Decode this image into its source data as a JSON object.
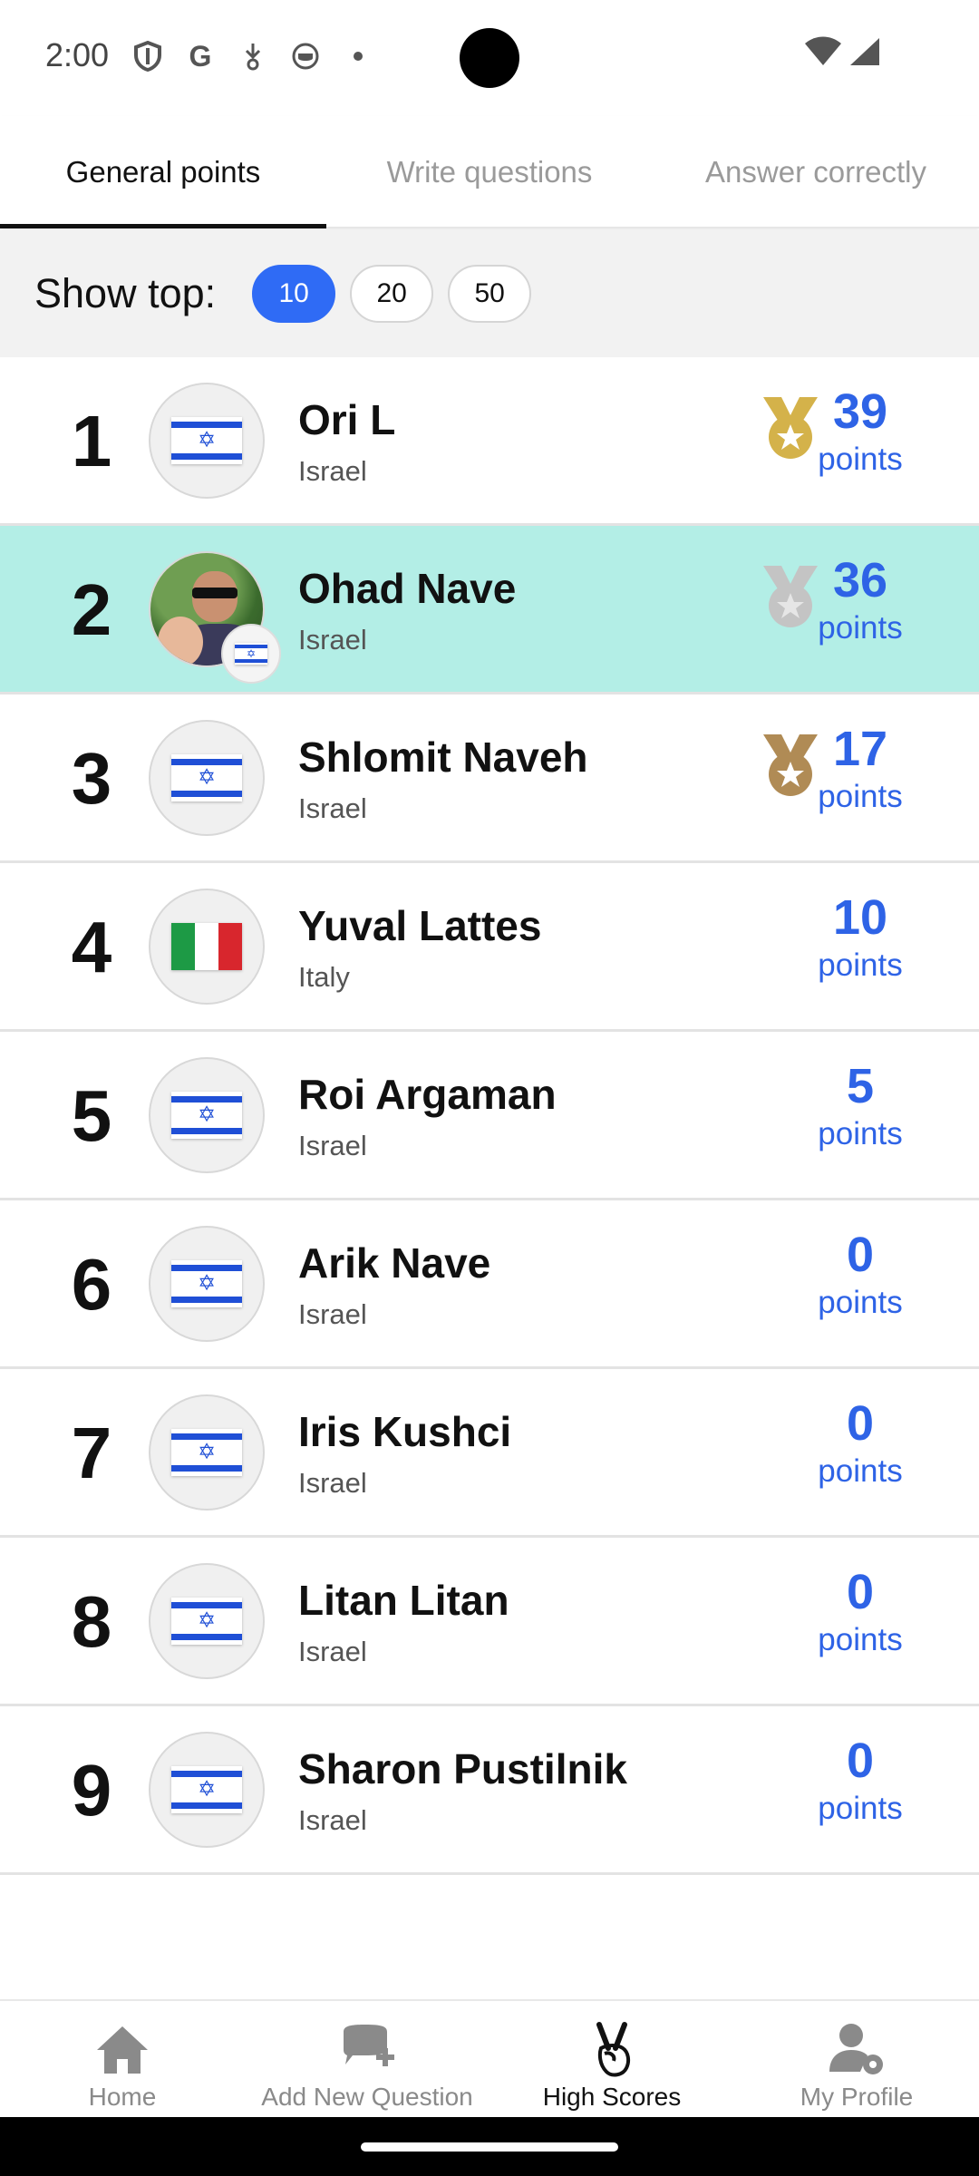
{
  "status_bar": {
    "time": "2:00"
  },
  "tabs": [
    {
      "label": "General points",
      "active": true
    },
    {
      "label": "Write questions",
      "active": false
    },
    {
      "label": "Answer correctly",
      "active": false
    }
  ],
  "show_top": {
    "label": "Show top:",
    "options": [
      "10",
      "20",
      "50"
    ],
    "selected": "10"
  },
  "scores": [
    {
      "rank": "1",
      "name": "Ori L",
      "country": "Israel",
      "points": "39",
      "unit": "points",
      "medal": "gold"
    },
    {
      "rank": "2",
      "name": "Ohad Nave",
      "country": "Israel",
      "points": "36",
      "unit": "points",
      "medal": "silver",
      "highlighted": true
    },
    {
      "rank": "3",
      "name": "Shlomit Naveh",
      "country": "Israel",
      "points": "17",
      "unit": "points",
      "medal": "bronze"
    },
    {
      "rank": "4",
      "name": "Yuval Lattes",
      "country": "Italy",
      "points": "10",
      "unit": "points"
    },
    {
      "rank": "5",
      "name": "Roi Argaman",
      "country": "Israel",
      "points": "5",
      "unit": "points"
    },
    {
      "rank": "6",
      "name": "Arik Nave",
      "country": "Israel",
      "points": "0",
      "unit": "points"
    },
    {
      "rank": "7",
      "name": "Iris Kushci",
      "country": "Israel",
      "points": "0",
      "unit": "points"
    },
    {
      "rank": "8",
      "name": "Litan Litan",
      "country": "Israel",
      "points": "0",
      "unit": "points"
    },
    {
      "rank": "9",
      "name": "Sharon Pustilnik",
      "country": "Israel",
      "points": "0",
      "unit": "points"
    }
  ],
  "colors": {
    "accent": "#2f6bf5",
    "points": "#2e63e6",
    "highlight_row": "#b3eee6",
    "gold": "#d4b24a",
    "silver": "#c4c4c4",
    "bronze": "#b08b55"
  },
  "bottom_nav": [
    {
      "label": "Home",
      "icon": "home-icon",
      "active": false
    },
    {
      "label": "Add New Question",
      "icon": "add-question-icon",
      "active": false
    },
    {
      "label": "High Scores",
      "icon": "victory-hand-icon",
      "active": true
    },
    {
      "label": "My Profile",
      "icon": "profile-settings-icon",
      "active": false
    }
  ]
}
